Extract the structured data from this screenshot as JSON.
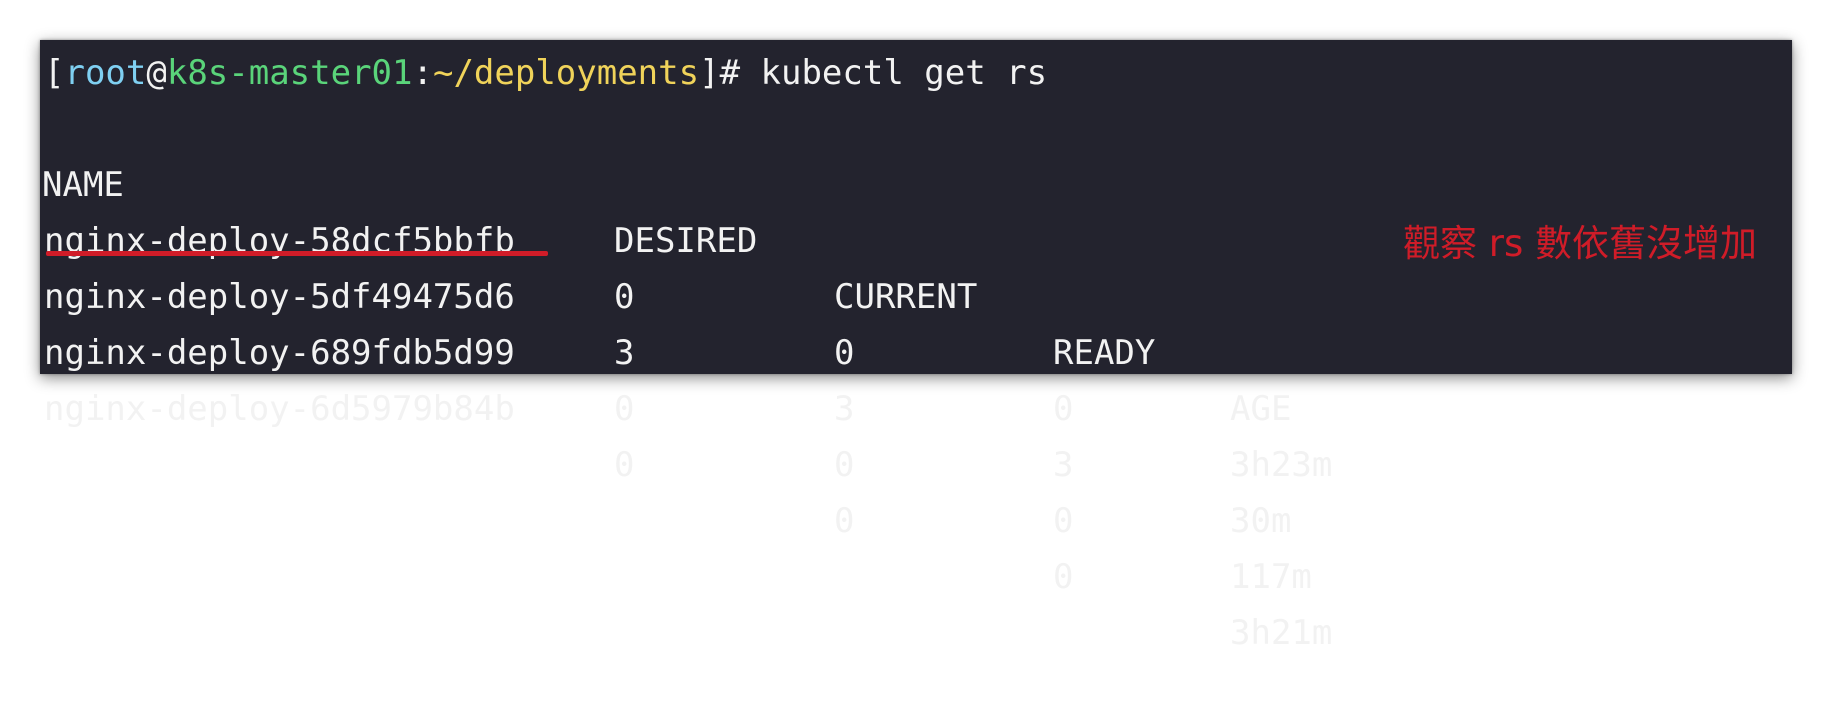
{
  "prompt": {
    "open_bracket": "[",
    "user": "root",
    "at": "@",
    "host": "k8s-master01",
    "colon": ":",
    "path": "~/deployments",
    "close_bracket_hash": "]#",
    "command": " kubectl get rs"
  },
  "table": {
    "headers": [
      "NAME",
      "DESIRED",
      "CURRENT",
      "READY",
      "AGE"
    ],
    "rows": [
      {
        "name": "nginx-deploy-58dcf5bbfb",
        "desired": "0",
        "current": "0",
        "ready": "0",
        "age": "3h23m"
      },
      {
        "name": "nginx-deploy-5df49475d6",
        "desired": "3",
        "current": "3",
        "ready": "3",
        "age": "30m"
      },
      {
        "name": "nginx-deploy-689fdb5d99",
        "desired": "0",
        "current": "0",
        "ready": "0",
        "age": "117m"
      },
      {
        "name": "nginx-deploy-6d5979b84b",
        "desired": "0",
        "current": "0",
        "ready": "0",
        "age": "3h21m"
      }
    ]
  },
  "annotation": {
    "text": "觀察 rs 數依舊沒增加",
    "color": "#d01c28"
  },
  "colors": {
    "background": "#23232e",
    "text": "#f2f2f2",
    "user": "#7fd0f2",
    "host": "#5ad47a",
    "path": "#f0d35a",
    "highlight": "#d01c28"
  }
}
